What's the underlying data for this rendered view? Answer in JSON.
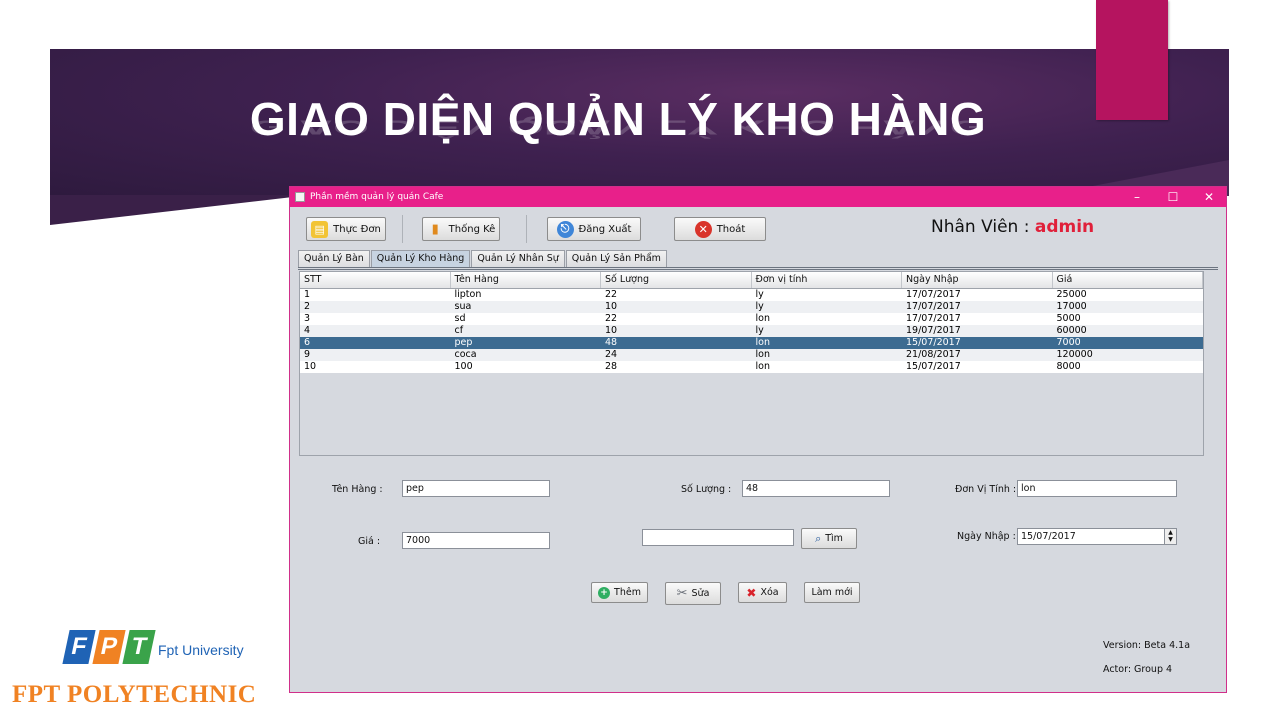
{
  "slide": {
    "title": "GIAO DIỆN QUẢN LÝ KHO HÀNG",
    "logo_fpt_letters": [
      "F",
      "P",
      "T"
    ],
    "logo_fpt_university": "Fpt University",
    "logo_polytechnic": "FPT POLYTECHNIC",
    "colors": {
      "banner": "#3f2150",
      "accent_pink": "#b5145f",
      "title_bar": "#e8208a"
    }
  },
  "window": {
    "title": "Phần mềm quản lý quán Cafe",
    "toolbar": {
      "menu_label": "Thực Đơn",
      "stats_label": "Thống Kê",
      "logout_label": "Đăng Xuất",
      "exit_label": "Thoát"
    },
    "employee_label": "Nhân Viên :",
    "employee_name": "admin",
    "tabs": [
      {
        "label": "Quản Lý Bàn"
      },
      {
        "label": "Quản Lý Kho Hàng",
        "active": true
      },
      {
        "label": "Quản Lý Nhân Sự"
      },
      {
        "label": "Quản Lý Sản Phẩm"
      }
    ],
    "table": {
      "columns": [
        "STT",
        "Tên Hàng",
        "Số Lượng",
        "Đơn vị tính",
        "Ngày Nhập",
        "Giá"
      ],
      "rows": [
        [
          "1",
          "lipton",
          "22",
          "ly",
          "17/07/2017",
          "25000"
        ],
        [
          "2",
          "sua",
          "10",
          "ly",
          "17/07/2017",
          "17000"
        ],
        [
          "3",
          "sd",
          "22",
          "lon",
          "17/07/2017",
          "5000"
        ],
        [
          "4",
          "cf",
          "10",
          "ly",
          "19/07/2017",
          "60000"
        ],
        [
          "6",
          "pep",
          "48",
          "lon",
          "15/07/2017",
          "7000"
        ],
        [
          "9",
          "coca",
          "24",
          "lon",
          "21/08/2017",
          "120000"
        ],
        [
          "10",
          "100",
          "28",
          "lon",
          "15/07/2017",
          "8000"
        ]
      ],
      "selected_row": 4
    },
    "form": {
      "name_label": "Tên Hàng :",
      "name_value": "pep",
      "qty_label": "Số Lượng :",
      "qty_value": "48",
      "unit_label": "Đơn Vị Tính :",
      "unit_value": "lon",
      "price_label": "Giá :",
      "price_value": "7000",
      "search_value": "",
      "search_button": "Tìm",
      "date_label": "Ngày Nhập :",
      "date_value": "15/07/2017"
    },
    "actions": {
      "add": "Thêm",
      "edit": "Sửa",
      "delete": "Xóa",
      "refresh": "Làm mới"
    },
    "version": "Version: Beta 4.1a",
    "actor": "Actor: Group 4"
  }
}
